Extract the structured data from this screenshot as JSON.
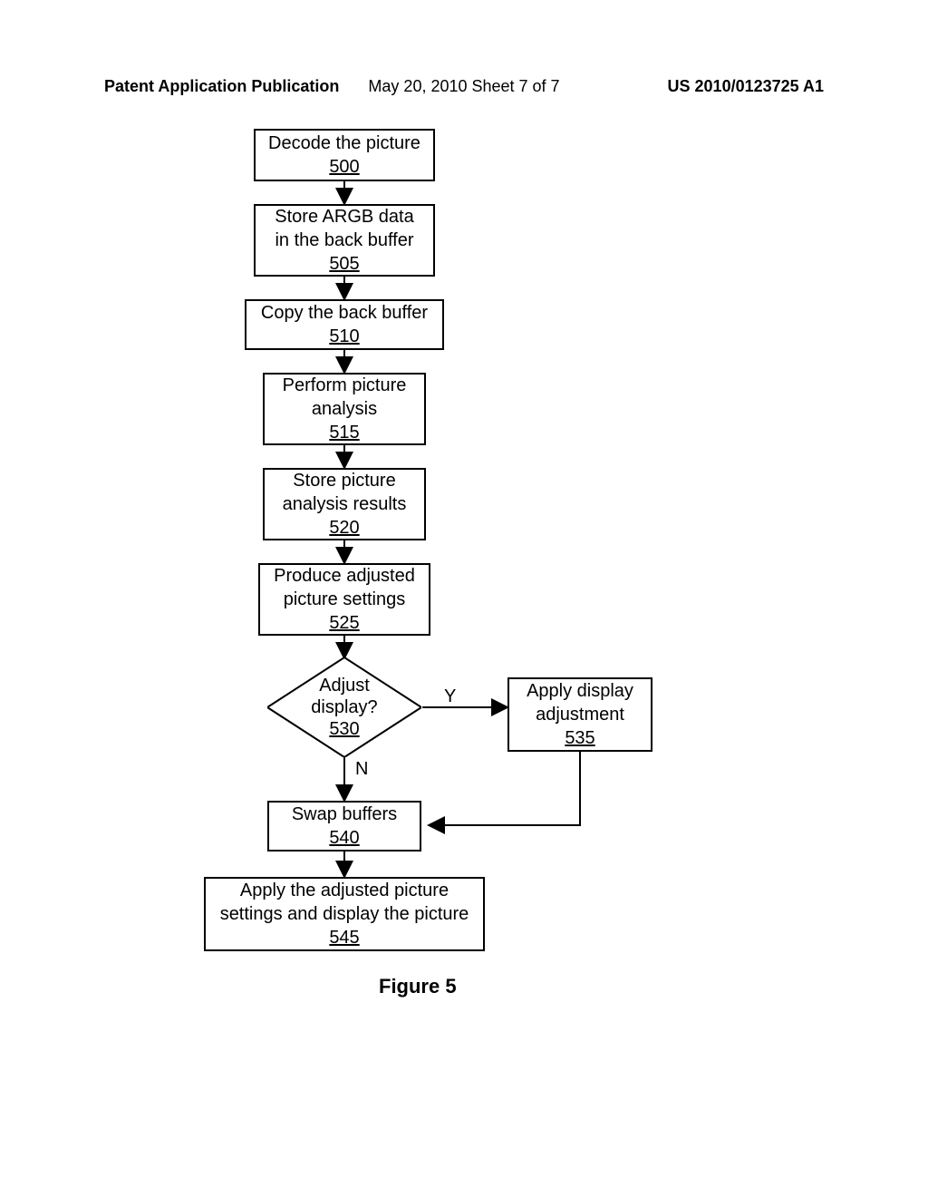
{
  "header": {
    "left": "Patent Application Publication",
    "center": "May 20, 2010  Sheet 7 of 7",
    "right": "US 2010/0123725 A1"
  },
  "boxes": {
    "b500": {
      "text": "Decode the picture",
      "ref": "500"
    },
    "b505": {
      "text1": "Store ARGB data",
      "text2": "in the back buffer",
      "ref": "505"
    },
    "b510": {
      "text": "Copy the back buffer",
      "ref": "510"
    },
    "b515": {
      "text1": "Perform picture",
      "text2": "analysis",
      "ref": "515"
    },
    "b520": {
      "text1": "Store picture",
      "text2": "analysis results",
      "ref": "520"
    },
    "b525": {
      "text1": "Produce adjusted",
      "text2": "picture settings",
      "ref": "525"
    },
    "d530": {
      "text1": "Adjust",
      "text2": "display?",
      "ref": "530"
    },
    "b535": {
      "text1": "Apply display",
      "text2": "adjustment",
      "ref": "535"
    },
    "b540": {
      "text": "Swap buffers",
      "ref": "540"
    },
    "b545": {
      "text1": "Apply the adjusted picture",
      "text2": "settings and display the picture",
      "ref": "545"
    }
  },
  "labels": {
    "yes": "Y",
    "no": "N"
  },
  "caption": "Figure 5"
}
